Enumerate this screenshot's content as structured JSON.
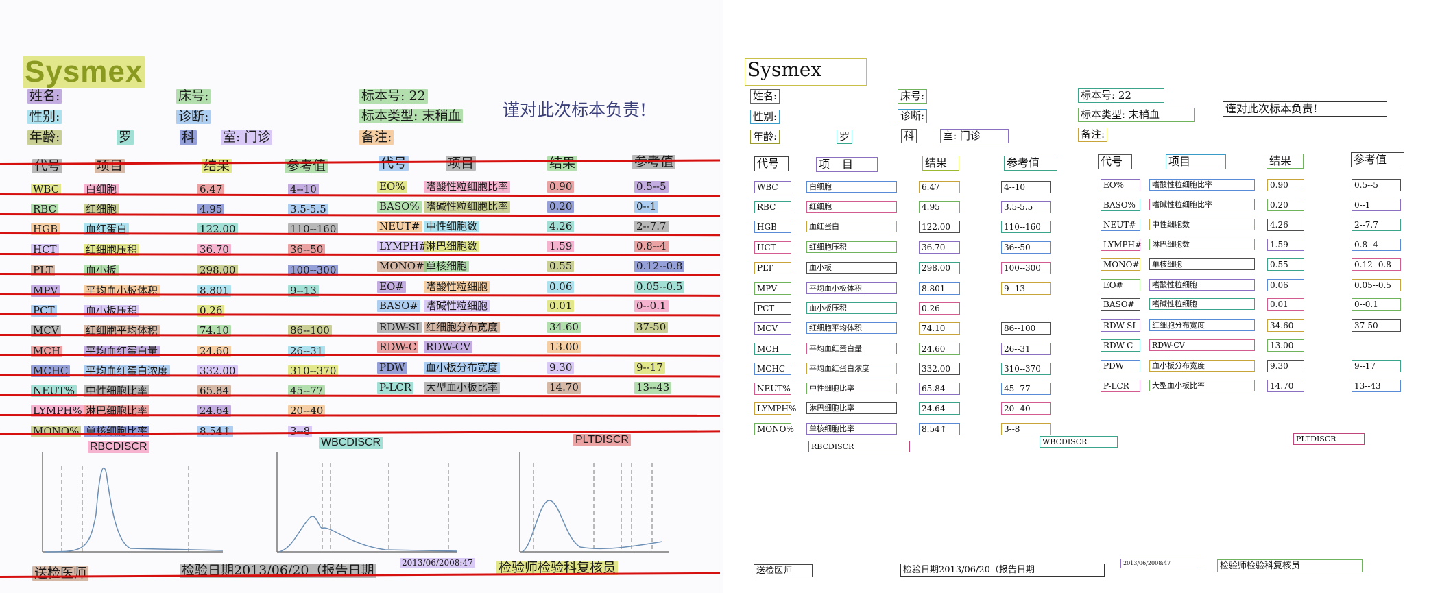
{
  "logo": "Sysmex",
  "header": {
    "name_label": "姓名:",
    "sex_label": "性别:",
    "age_label": "年龄:",
    "bed_label": "床号:",
    "diag_label": "诊断:",
    "sample_no_label": "标本号: 22",
    "sample_type_label": "标本类型: 末稍血",
    "note_label": "备注:",
    "dept_1": "罗",
    "dept_2": "科",
    "room": "室: 门诊",
    "responsible": "谨对此次标本负责!"
  },
  "table_headers": {
    "code": "代号",
    "item": "项目",
    "result": "结果",
    "reference": "参考值"
  },
  "left_rows": [
    {
      "code": "WBC",
      "item": "白细胞",
      "result": "6.47",
      "ref": "4--10"
    },
    {
      "code": "RBC",
      "item": "红细胞",
      "result": "4.95",
      "ref": "3.5-5.5"
    },
    {
      "code": "HGB",
      "item": "血红蛋白",
      "result": "122.00",
      "ref": "110--160"
    },
    {
      "code": "HCT",
      "item": "红细胞压积",
      "result": "36.70",
      "ref": "36--50"
    },
    {
      "code": "PLT",
      "item": "血小板",
      "result": "298.00",
      "ref": "100--300"
    },
    {
      "code": "MPV",
      "item": "平均血小板体积",
      "result": "8.801",
      "ref": "9--13"
    },
    {
      "code": "PCT",
      "item": "血小板压积",
      "result": "0.26",
      "ref": ""
    },
    {
      "code": "MCV",
      "item": "红细胞平均体积",
      "result": "74.10",
      "ref": "86--100"
    },
    {
      "code": "MCH",
      "item": "平均血红蛋白量",
      "result": "24.60",
      "ref": "26--31"
    },
    {
      "code": "MCHC",
      "item": "平均血红蛋白浓度",
      "result": "332.00",
      "ref": "310--370"
    },
    {
      "code": "NEUT%",
      "item": "中性细胞比率",
      "result": "65.84",
      "ref": "45--77"
    },
    {
      "code": "LYMPH%",
      "item": "淋巴细胞比率",
      "result": "24.64",
      "ref": "20--40"
    },
    {
      "code": "MONO%",
      "item": "单核细胞比率",
      "result": "8.54↑",
      "ref": "3--8"
    }
  ],
  "right_rows": [
    {
      "code": "EO%",
      "item": "嗜酸性粒细胞比率",
      "result": "0.90",
      "ref": "0.5--5"
    },
    {
      "code": "BASO%",
      "item": "嗜碱性粒细胞比率",
      "result": "0.20",
      "ref": "0--1"
    },
    {
      "code": "NEUT#",
      "item": "中性细胞数",
      "result": "4.26",
      "ref": "2--7.7"
    },
    {
      "code": "LYMPH#",
      "item": "淋巴细胞数",
      "result": "1.59",
      "ref": "0.8--4"
    },
    {
      "code": "MONO#",
      "item": "单核细胞",
      "result": "0.55",
      "ref": "0.12--0.8"
    },
    {
      "code": "EO#",
      "item": "嗜酸性粒细胞",
      "result": "0.06",
      "ref": "0.05--0.5"
    },
    {
      "code": "BASO#",
      "item": "嗜碱性粒细胞",
      "result": "0.01",
      "ref": "0--0.1"
    },
    {
      "code": "RDW-SI",
      "item": "红细胞分布宽度",
      "result": "34.60",
      "ref": "37-50"
    },
    {
      "code": "RDW-C",
      "item": "RDW-CV",
      "result": "13.00",
      "ref": ""
    },
    {
      "code": "PDW",
      "item": "血小板分布宽度",
      "result": "9.30",
      "ref": "9--17"
    },
    {
      "code": "P-LCR",
      "item": "大型血小板比率",
      "result": "14.70",
      "ref": "13--43"
    }
  ],
  "histograms": {
    "rbc": "RBCDISCR",
    "wbc": "WBCDISCR",
    "plt": "PLTDISCR"
  },
  "footer": {
    "doctor": "送检医师",
    "test_date": "检验日期2013/06/20（报告日期",
    "timestamp": "2013/06/2008:47",
    "verifier": "检验师检验科复核员"
  },
  "colors": {
    "strike_line": "#d60f0f",
    "right_box_palette": [
      "#8b6fc0",
      "#3aa58a",
      "#5a8bd6",
      "#d25b8f",
      "#c9a43a",
      "#6fb35d",
      "#4f4f4f"
    ]
  }
}
